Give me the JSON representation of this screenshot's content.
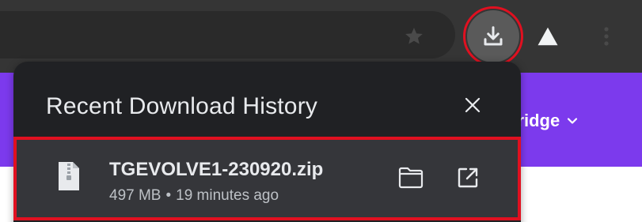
{
  "popup": {
    "title": "Recent Download History",
    "item": {
      "file_name": "TGEVOLVE1-230920.zip",
      "size": "497 MB",
      "separator": "•",
      "time": "19 minutes ago"
    }
  },
  "site_header": {
    "nav_item_label": "bridge"
  },
  "icons": {
    "star": "star-icon",
    "download": "download-icon",
    "profile": "profile-icon",
    "menu": "kebab-menu-icon",
    "close": "close-icon",
    "file": "file-zip-icon",
    "folder": "folder-icon",
    "open": "open-external-icon",
    "chevron": "chevron-down-icon"
  },
  "colors": {
    "toolbar": "#353535",
    "popup_bg": "#202124",
    "item_bg": "#35363a",
    "highlight": "#e01020",
    "site_header": "#7c3aed",
    "text_primary": "#e8eaed",
    "text_secondary": "#bdc1c6"
  }
}
